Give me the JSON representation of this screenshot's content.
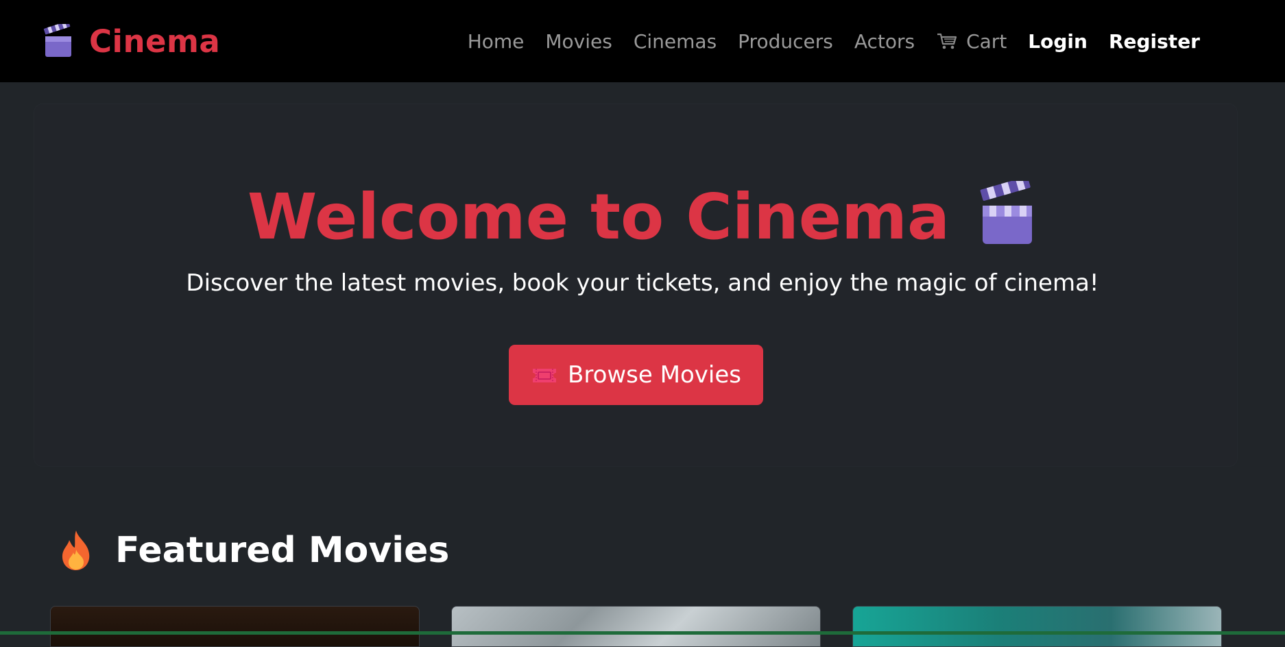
{
  "navbar": {
    "brand": "Cinema",
    "links": {
      "home": "Home",
      "movies": "Movies",
      "cinemas": "Cinemas",
      "producers": "Producers",
      "actors": "Actors",
      "cart": "Cart",
      "login": "Login",
      "register": "Register"
    }
  },
  "hero": {
    "title": "Welcome to Cinema",
    "subtitle": "Discover the latest movies, book your tickets, and enjoy the magic of cinema!",
    "button_label": "Browse Movies"
  },
  "featured": {
    "heading": "Featured Movies"
  },
  "colors": {
    "accent": "#dc3545",
    "navbar_bg": "#000000",
    "page_bg": "#212529"
  },
  "icons": {
    "brand": "clapperboard-icon",
    "cart": "cart-icon",
    "hero": "clapperboard-icon",
    "button": "ticket-icon",
    "featured": "fire-icon"
  }
}
